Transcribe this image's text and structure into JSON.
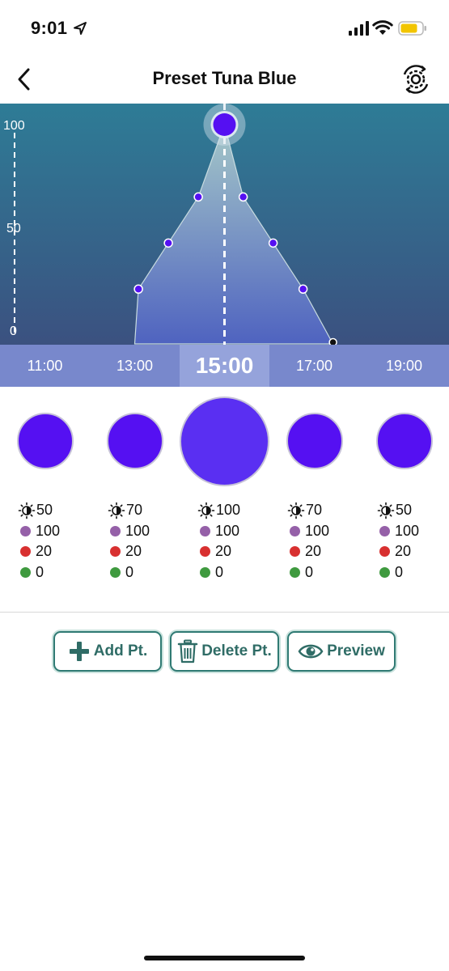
{
  "status_bar": {
    "time": "9:01"
  },
  "nav": {
    "title": "Preset Tuna Blue"
  },
  "chart": {
    "y_ticks": [
      "100",
      "50",
      "0"
    ],
    "selected_time": "15:00",
    "points": [
      {
        "time": "13:00",
        "value": 0,
        "kind": "end"
      },
      {
        "time": "13:05",
        "value": 25
      },
      {
        "time": "13:45",
        "value": 46
      },
      {
        "time": "14:25",
        "value": 67
      },
      {
        "time": "15:00",
        "value": 100,
        "selected": true
      },
      {
        "time": "15:25",
        "value": 67
      },
      {
        "time": "16:05",
        "value": 46
      },
      {
        "time": "16:45",
        "value": 25
      },
      {
        "time": "17:25",
        "value": 0,
        "kind": "end"
      }
    ]
  },
  "timeline": {
    "labels": [
      "11:00",
      "13:00",
      "15:00",
      "17:00",
      "19:00"
    ],
    "active_index": 2
  },
  "columns": [
    {
      "brightness": "50",
      "purple": "100",
      "red": "20",
      "green": "0",
      "color": "#5510f2"
    },
    {
      "brightness": "70",
      "purple": "100",
      "red": "20",
      "green": "0",
      "color": "#5510f2"
    },
    {
      "brightness": "100",
      "purple": "100",
      "red": "20",
      "green": "0",
      "color": "#5a2ff2"
    },
    {
      "brightness": "70",
      "purple": "100",
      "red": "20",
      "green": "0",
      "color": "#5510f2"
    },
    {
      "brightness": "50",
      "purple": "100",
      "red": "20",
      "green": "0",
      "color": "#5510f2"
    }
  ],
  "actions": {
    "add_label": "Add Pt.",
    "delete_label": "Delete Pt.",
    "preview_label": "Preview"
  },
  "colors": {
    "chart_top": "#2e7c96",
    "chart_bottom": "#3b5180",
    "accent": "#2f7a73",
    "point": "#5510f2",
    "purple_dot": "#9560a8",
    "red_dot": "#d83030",
    "green_dot": "#3f9a3f"
  },
  "icons": {
    "back": "chevron-left-icon",
    "sync": "gear-sync-icon",
    "add": "plus-icon",
    "delete": "trash-icon",
    "preview": "eye-icon",
    "brightness": "brightness-icon"
  }
}
